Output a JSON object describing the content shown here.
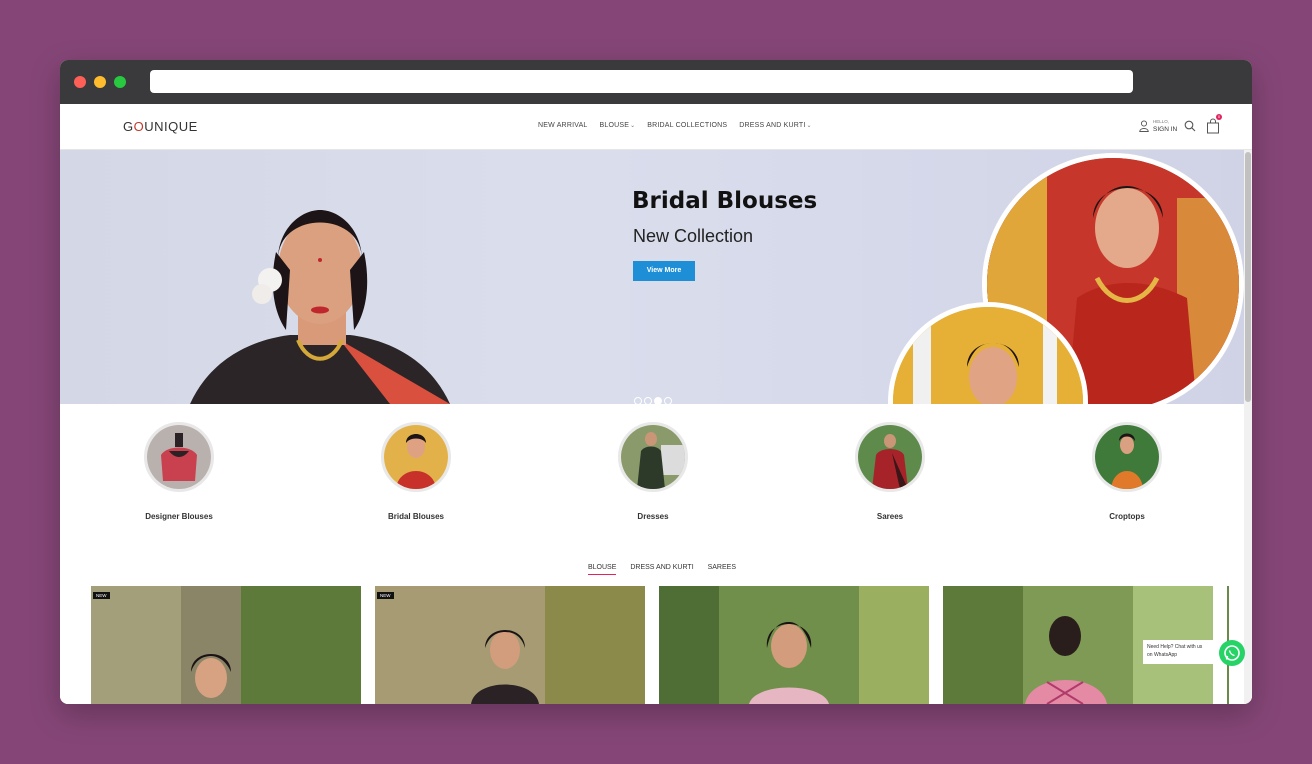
{
  "browser": {
    "url": ""
  },
  "header": {
    "logo_text": "GUNIQUE",
    "logo_initial": "G",
    "logo_mid": "O",
    "logo_rest": "UNIQUE",
    "nav": [
      {
        "label": "NEW ARRIVAL",
        "has_dropdown": false
      },
      {
        "label": "BLOUSE",
        "has_dropdown": true
      },
      {
        "label": "BRIDAL COLLECTIONS",
        "has_dropdown": false
      },
      {
        "label": "DRESS AND KURTI",
        "has_dropdown": true
      }
    ],
    "account": {
      "hello": "HELLO,",
      "signin": "SIGN IN",
      "icon": "user-icon"
    },
    "search_icon": "search-icon",
    "cart": {
      "icon": "shopping-bag-icon",
      "count": "0"
    }
  },
  "hero": {
    "title": "Bridal Blouses",
    "subtitle": "New Collection",
    "button": "View More",
    "slides": 4,
    "active_slide": 3
  },
  "categories": [
    {
      "label": "Designer Blouses"
    },
    {
      "label": "Bridal Blouses"
    },
    {
      "label": "Dresses"
    },
    {
      "label": "Sarees"
    },
    {
      "label": "Croptops"
    }
  ],
  "product_tabs": [
    {
      "label": "BLOUSE",
      "active": true
    },
    {
      "label": "DRESS AND KURTI",
      "active": false
    },
    {
      "label": "SAREES",
      "active": false
    }
  ],
  "products": [
    {
      "badge": "NEW"
    },
    {
      "badge": "NEW"
    },
    {
      "badge": ""
    },
    {
      "badge": ""
    }
  ],
  "chat": {
    "line1": "Need Help? Chat with us",
    "line2": "on WhatsApp",
    "icon": "whatsapp-icon"
  },
  "colors": {
    "accent": "#e0245e",
    "button": "#1e8fd6",
    "background": "#854677",
    "whatsapp": "#25d366"
  }
}
